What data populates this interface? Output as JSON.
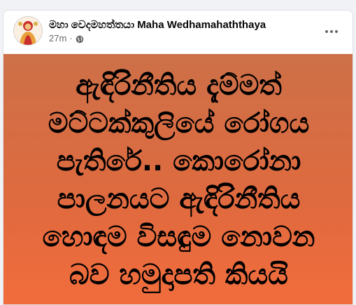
{
  "post": {
    "author": "මහා වෙදමහත්තයා Maha Wedhamahaththaya",
    "time": "27m",
    "separator": "·",
    "privacy_icon": "globe-icon",
    "more_icon": "more-horizontal-icon"
  },
  "image": {
    "lines": [
      "ඇඳිරිනීතිය දැම්මත්",
      "මට්ටක්කුලියේ රෝගය",
      "පැතිරේ.. කොරෝනා",
      "පාලනයට ඇඳිරිනීතිය",
      "හොඳම විසඳුම නොවන",
      "බව හමුදාපති කියයි"
    ],
    "gradient_top": "#cd7048",
    "gradient_bottom": "#f26c3c",
    "text_color": "#000000"
  }
}
